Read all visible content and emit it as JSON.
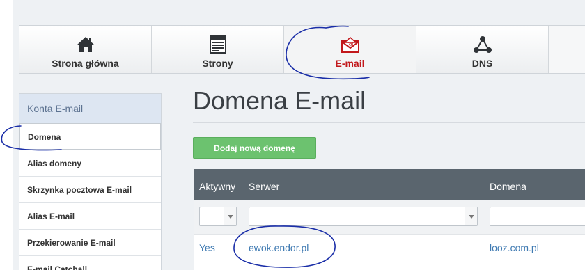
{
  "nav": {
    "items": [
      {
        "label": "Strona główna",
        "icon": "home-icon"
      },
      {
        "label": "Strony",
        "icon": "page-icon"
      },
      {
        "label": "E-mail",
        "icon": "email-icon",
        "active": true
      },
      {
        "label": "DNS",
        "icon": "dns-network-icon"
      }
    ]
  },
  "sidebar": {
    "header": "Konta E-mail",
    "items": [
      {
        "label": "Domena",
        "active": true
      },
      {
        "label": "Alias domeny"
      },
      {
        "label": "Skrzynka pocztowa E-mail"
      },
      {
        "label": "Alias E-mail"
      },
      {
        "label": "Przekierowanie E-mail"
      },
      {
        "label": "E-mail Catchall"
      }
    ]
  },
  "main": {
    "title": "Domena E-mail",
    "add_button": "Dodaj nową domenę",
    "table": {
      "columns": [
        "Aktywny",
        "Serwer",
        "Domena"
      ],
      "rows": [
        {
          "aktywny": "Yes",
          "serwer": "ewok.endor.pl",
          "domena": "looz.com.pl"
        }
      ]
    }
  },
  "colors": {
    "active_nav_label": "#c2181c",
    "add_button": "#6cc26f",
    "table_header": "#5a656e",
    "link": "#3f7ab2",
    "annotation_ink": "#1a2ea8"
  }
}
